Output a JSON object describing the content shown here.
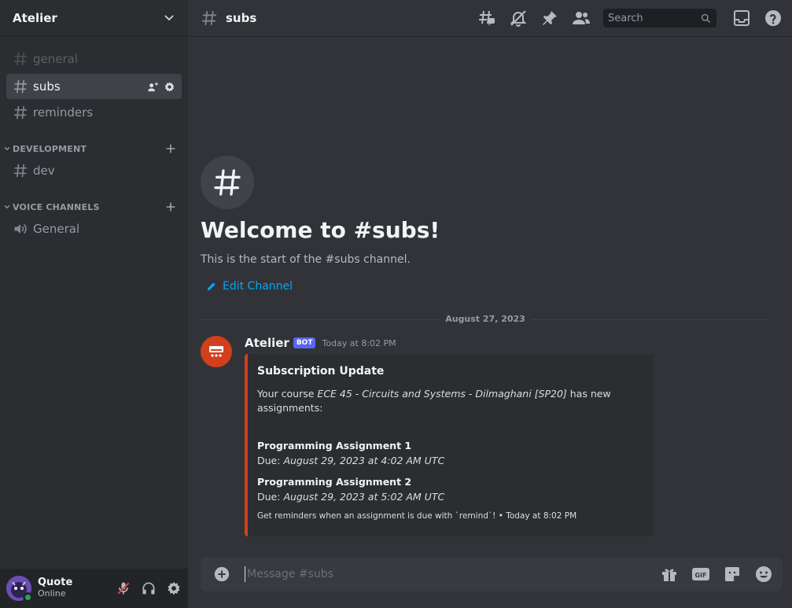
{
  "server": {
    "name": "Atelier"
  },
  "channels": [
    {
      "name": "general",
      "state": "muted"
    },
    {
      "name": "subs",
      "state": "active"
    },
    {
      "name": "reminders",
      "state": "normal"
    }
  ],
  "categories": {
    "development": {
      "label": "DEVELOPMENT",
      "channels": [
        {
          "name": "dev"
        }
      ]
    },
    "voice": {
      "label": "VOICE CHANNELS",
      "channels": [
        {
          "name": "General"
        }
      ]
    }
  },
  "user": {
    "name": "Quote",
    "status": "Online"
  },
  "topbar": {
    "channel": "subs",
    "search_placeholder": "Search"
  },
  "welcome": {
    "title": "Welcome to #subs!",
    "subtitle": "This is the start of the #subs channel.",
    "edit_label": "Edit Channel"
  },
  "divider_date": "August 27, 2023",
  "message": {
    "author": "Atelier",
    "tag": "BOT",
    "timestamp": "Today at 8:02 PM",
    "accent_color": "#d23f1c",
    "embed": {
      "title": "Subscription Update",
      "desc_prefix": "Your course ",
      "course": "ECE 45 - Circuits and Systems - Dilmaghani [SP20]",
      "desc_suffix": " has new assignments:",
      "fields": [
        {
          "name": "Programming Assignment 1",
          "due_label": "Due: ",
          "due": "August 29, 2023 at 4:02 AM UTC"
        },
        {
          "name": "Programming Assignment 2",
          "due_label": "Due: ",
          "due": "August 29, 2023 at 5:02 AM UTC"
        }
      ],
      "footer": "Get reminders when an assignment is due with `remind`! • Today at 8:02 PM"
    }
  },
  "composer": {
    "placeholder": "Message #subs"
  },
  "colors": {
    "online": "#23a55a",
    "link": "#00a8fc",
    "bot_tag": "#5865f2"
  },
  "icons": [
    "chevron-down-icon",
    "hashtag-icon",
    "add-member-icon",
    "gear-icon",
    "plus-icon",
    "speaker-icon",
    "threads-icon",
    "mute-bell-icon",
    "pin-icon",
    "members-icon",
    "search-icon",
    "inbox-icon",
    "help-icon",
    "pencil-icon",
    "mic-muted-icon",
    "headphones-icon",
    "gift-icon",
    "gif-icon",
    "sticker-icon",
    "emoji-icon"
  ]
}
